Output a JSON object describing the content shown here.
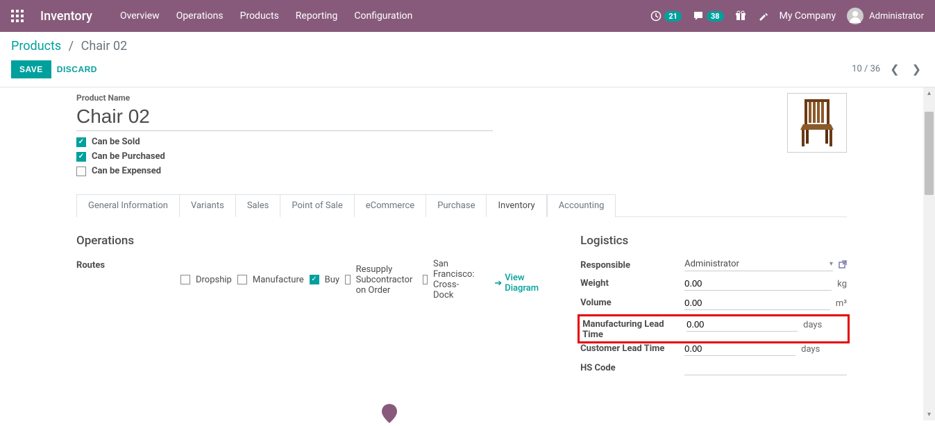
{
  "topnav": {
    "app_title": "Inventory",
    "menu": [
      "Overview",
      "Operations",
      "Products",
      "Reporting",
      "Configuration"
    ],
    "activity_count": "21",
    "message_count": "38",
    "company": "My Company",
    "user": "Administrator"
  },
  "breadcrumb": {
    "root": "Products",
    "current": "Chair 02"
  },
  "buttons": {
    "save": "SAVE",
    "discard": "DISCARD"
  },
  "pager": {
    "pos": "10 / 36"
  },
  "product": {
    "name_label": "Product Name",
    "name": "Chair 02",
    "can_sold_label": "Can be Sold",
    "can_purchased_label": "Can be Purchased",
    "can_expensed_label": "Can be Expensed"
  },
  "tabs": [
    "General Information",
    "Variants",
    "Sales",
    "Point of Sale",
    "eCommerce",
    "Purchase",
    "Inventory",
    "Accounting"
  ],
  "operations": {
    "title": "Operations",
    "routes_label": "Routes",
    "routes": [
      {
        "label": "Dropship",
        "checked": false
      },
      {
        "label": "Manufacture",
        "checked": false
      },
      {
        "label": "Buy",
        "checked": true
      },
      {
        "label": "Resupply Subcontractor on Order",
        "checked": false
      },
      {
        "label": "San Francisco: Cross-Dock",
        "checked": false
      }
    ],
    "view_diagram": "View Diagram"
  },
  "logistics": {
    "title": "Logistics",
    "responsible_label": "Responsible",
    "responsible_value": "Administrator",
    "weight_label": "Weight",
    "weight_value": "0.00",
    "weight_unit": "kg",
    "volume_label": "Volume",
    "volume_value": "0.00",
    "volume_unit": "m³",
    "mlt_label": "Manufacturing Lead Time",
    "mlt_value": "0.00",
    "mlt_unit": "days",
    "clt_label": "Customer Lead Time",
    "clt_value": "0.00",
    "clt_unit": "days",
    "hs_label": "HS Code"
  }
}
